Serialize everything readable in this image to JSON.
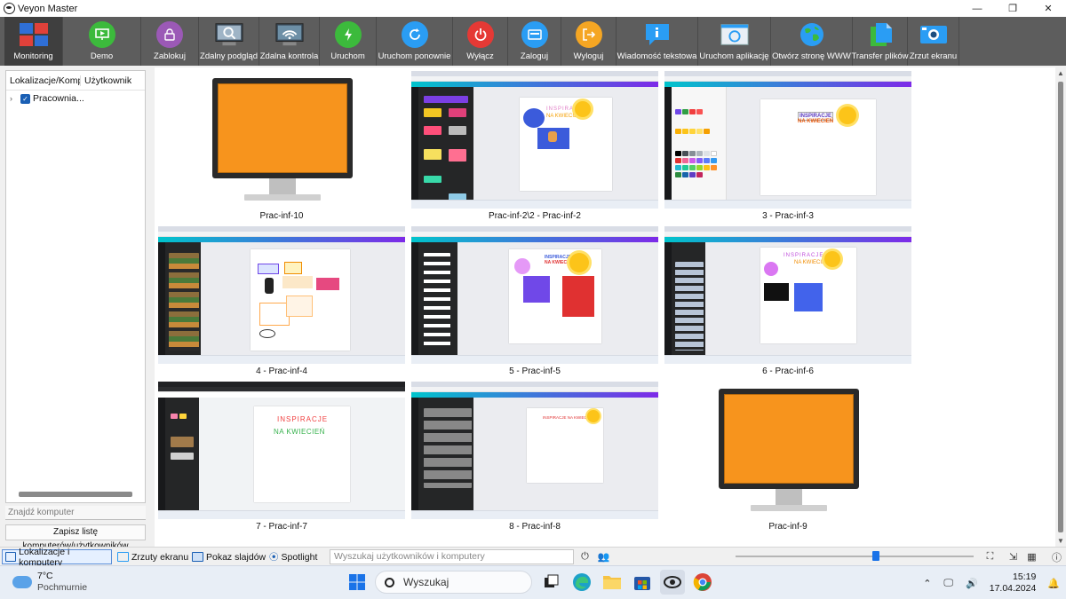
{
  "window": {
    "title": "Veyon Master",
    "controls": [
      "—",
      "❐",
      "✕"
    ]
  },
  "toolbar": [
    {
      "label": "Monitoring",
      "icon": "monitoring-icon",
      "color": "#2f6fd6",
      "active": true
    },
    {
      "label": "Demo",
      "icon": "demo-icon",
      "color": "#3cba3c"
    },
    {
      "label": "Zablokuj",
      "icon": "lock-icon",
      "color": "#9b59b6"
    },
    {
      "label": "Zdalny podgląd",
      "icon": "remote-view-icon",
      "color": "#7a8a99"
    },
    {
      "label": "Zdalna kontrola",
      "icon": "remote-control-icon",
      "color": "#5d7e91"
    },
    {
      "label": "Uruchom",
      "icon": "power-on-icon",
      "color": "#3cba3c"
    },
    {
      "label": "Uruchom ponownie",
      "icon": "reboot-icon",
      "color": "#2a9df4"
    },
    {
      "label": "Wyłącz",
      "icon": "power-off-icon",
      "color": "#e53935"
    },
    {
      "label": "Zaloguj",
      "icon": "login-icon",
      "color": "#2a9df4"
    },
    {
      "label": "Wyloguj",
      "icon": "logout-icon",
      "color": "#f5a623"
    },
    {
      "label": "Wiadomość tekstowa",
      "icon": "message-icon",
      "color": "#2a9df4"
    },
    {
      "label": "Uruchom aplikację",
      "icon": "run-program-icon",
      "color": "#d9e6f2"
    },
    {
      "label": "Otwórz stronę WWW",
      "icon": "globe-icon",
      "color": "#2a9df4"
    },
    {
      "label": "Transfer plików",
      "icon": "file-transfer-icon",
      "color": "#2a9df4"
    },
    {
      "label": "Zrzut ekranu",
      "icon": "screenshot-icon",
      "color": "#2a9df4"
    }
  ],
  "sidebar": {
    "col_location": "Lokalizacje/Komputery",
    "col_user": "Użytkownik",
    "items": [
      {
        "label": "Pracownia..."
      }
    ],
    "find_placeholder": "Znajdź komputer",
    "save_button": "Zapisz listę komputerów/użytkowników"
  },
  "computers": [
    {
      "name": "Prac-inf-10",
      "state": "offline"
    },
    {
      "name": "Prac-inf-2\\2 - Prac-inf-2",
      "state": "screen"
    },
    {
      "name": "3 - Prac-inf-3",
      "state": "screen"
    },
    {
      "name": "4 - Prac-inf-4",
      "state": "screen"
    },
    {
      "name": "5 - Prac-inf-5",
      "state": "screen"
    },
    {
      "name": "6 - Prac-inf-6",
      "state": "screen"
    },
    {
      "name": "7 - Prac-inf-7",
      "state": "screen"
    },
    {
      "name": "8 - Prac-inf-8",
      "state": "screen"
    },
    {
      "name": "Prac-inf-9",
      "state": "offline"
    }
  ],
  "screen_text": {
    "inspiracje_line1": "INSPIRACJE",
    "inspiracje_line2": "NA KWIECIEŃ",
    "inspiracje_full": "INSPIRACJE NA KWIECIEŃ"
  },
  "statusbar": {
    "tabs": [
      "Lokalizacje i komputery",
      "Zrzuty ekranu",
      "Pokaz slajdów",
      "Spotlight"
    ],
    "search_placeholder": "Wyszukaj użytkowników i komputery",
    "zoom_fraction": 0.59
  },
  "taskbar": {
    "weather_temp": "7°C",
    "weather_desc": "Pochmurnie",
    "search_label": "Wyszukaj",
    "time": "15:19",
    "date": "17.04.2024"
  },
  "colors": {
    "toolbar_bg": "#5d5d5d",
    "monitor_screen": "#f7941d",
    "accent": "#1a73e8"
  }
}
